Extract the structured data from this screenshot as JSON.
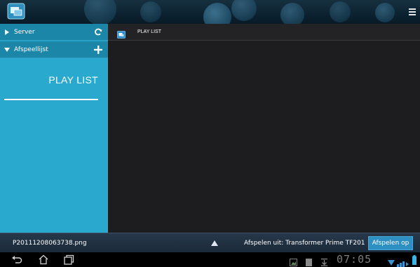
{
  "sidebar": {
    "items": [
      {
        "label": "Server",
        "icon": "refresh-icon"
      },
      {
        "label": "Afspeellijst",
        "icon": "add-icon"
      }
    ],
    "title": "PLAY LIST"
  },
  "main": {
    "header_title": "PLAY LIST"
  },
  "player": {
    "file_name": "P20111208063738.png",
    "source_text": "Afspelen uit: Transformer Prime TF201",
    "play_button": "Afspelen op"
  },
  "status_bar": {
    "time": "07:05"
  },
  "colors": {
    "sidebar": "#2aa9cf",
    "sidebar_row": "#1c86a8",
    "main_bg": "#1d1d1f",
    "accent_button": "#2e8fc2"
  }
}
